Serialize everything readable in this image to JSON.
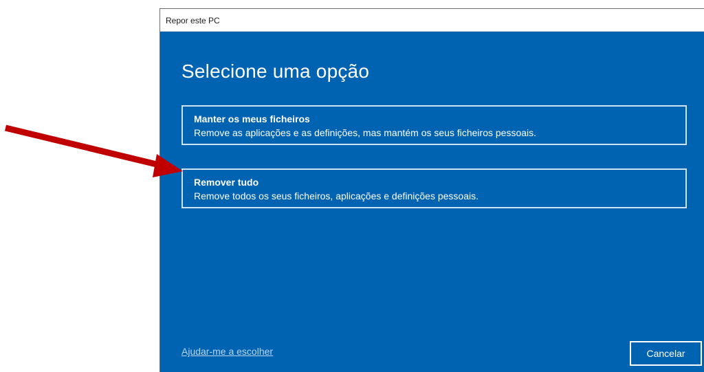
{
  "window": {
    "title": "Repor este PC"
  },
  "dialog": {
    "heading": "Selecione uma opção",
    "options": [
      {
        "title": "Manter os meus ficheiros",
        "description": "Remove as aplicações e as definições, mas mantém os seus ficheiros pessoais."
      },
      {
        "title": "Remover tudo",
        "description": "Remove todos os seus ficheiros, aplicações e definições pessoais."
      }
    ],
    "help_link": "Ajudar-me a escolher",
    "cancel_label": "Cancelar"
  },
  "annotation": {
    "arrow_color": "#c00000",
    "arrow_target": "Remover tudo"
  },
  "colors": {
    "window_background": "#0063b1",
    "title_bar": "#ffffff",
    "text": "#ffffff"
  }
}
